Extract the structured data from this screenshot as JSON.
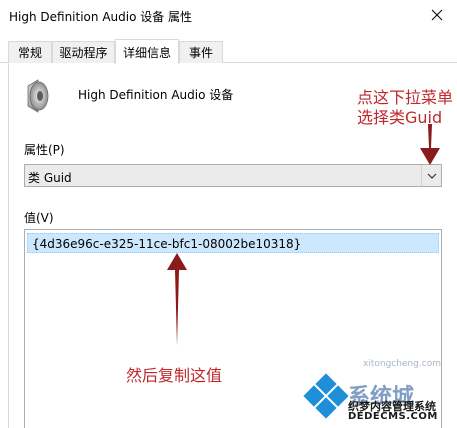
{
  "window": {
    "title": "High Definition Audio 设备 属性",
    "close_icon": "close-icon"
  },
  "tabs": [
    {
      "label": "常规",
      "active": false
    },
    {
      "label": "驱动程序",
      "active": false
    },
    {
      "label": "详细信息",
      "active": true
    },
    {
      "label": "事件",
      "active": false
    }
  ],
  "device": {
    "icon": "speaker-icon",
    "name": "High Definition Audio 设备"
  },
  "property": {
    "label": "属性(P)",
    "selected": "类 Guid"
  },
  "value": {
    "label": "值(V)",
    "items": [
      "{4d36e96c-e325-11ce-bfc1-08002be10318}"
    ]
  },
  "annotations": {
    "top_line1": "点这下拉菜单",
    "top_line2": "选择类Guid",
    "bottom": "然后复制这值"
  },
  "watermark": {
    "url": "xitongcheng.com",
    "brand": "系统城",
    "line2": "织梦内容管理系统",
    "line3": "DEDECMS.COM"
  },
  "colors": {
    "annotation": "#c0282c",
    "selection": "#cce8ff",
    "arrow": "#8b1a1a"
  }
}
